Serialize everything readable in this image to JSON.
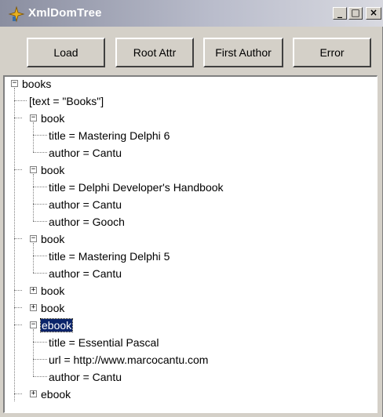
{
  "window": {
    "title": "XmlDomTree"
  },
  "caption_buttons": {
    "minimize": "_",
    "maximize": "□",
    "close": "×"
  },
  "toolbar": {
    "load_label": "Load",
    "root_attr_label": "Root Attr",
    "first_author_label": "First Author",
    "error_label": "Error"
  },
  "tree": {
    "books": "books",
    "text_books": "[text = \"Books\"]",
    "book1": "book",
    "book1_title": "title = Mastering Delphi 6",
    "book1_author": "author = Cantu",
    "book2": "book",
    "book2_title": "title = Delphi Developer's Handbook",
    "book2_author1": "author = Cantu",
    "book2_author2": "author = Gooch",
    "book3": "book",
    "book3_title": "title = Mastering Delphi 5",
    "book3_author": "author = Cantu",
    "book4": "book",
    "book5": "book",
    "ebook1": "ebook",
    "ebook1_title": "title = Essential Pascal",
    "ebook1_url": "url = http://www.marcocantu.com",
    "ebook1_author": "author = Cantu",
    "ebook2": "ebook",
    "expanded_sign": "−",
    "collapsed_sign": "+"
  }
}
